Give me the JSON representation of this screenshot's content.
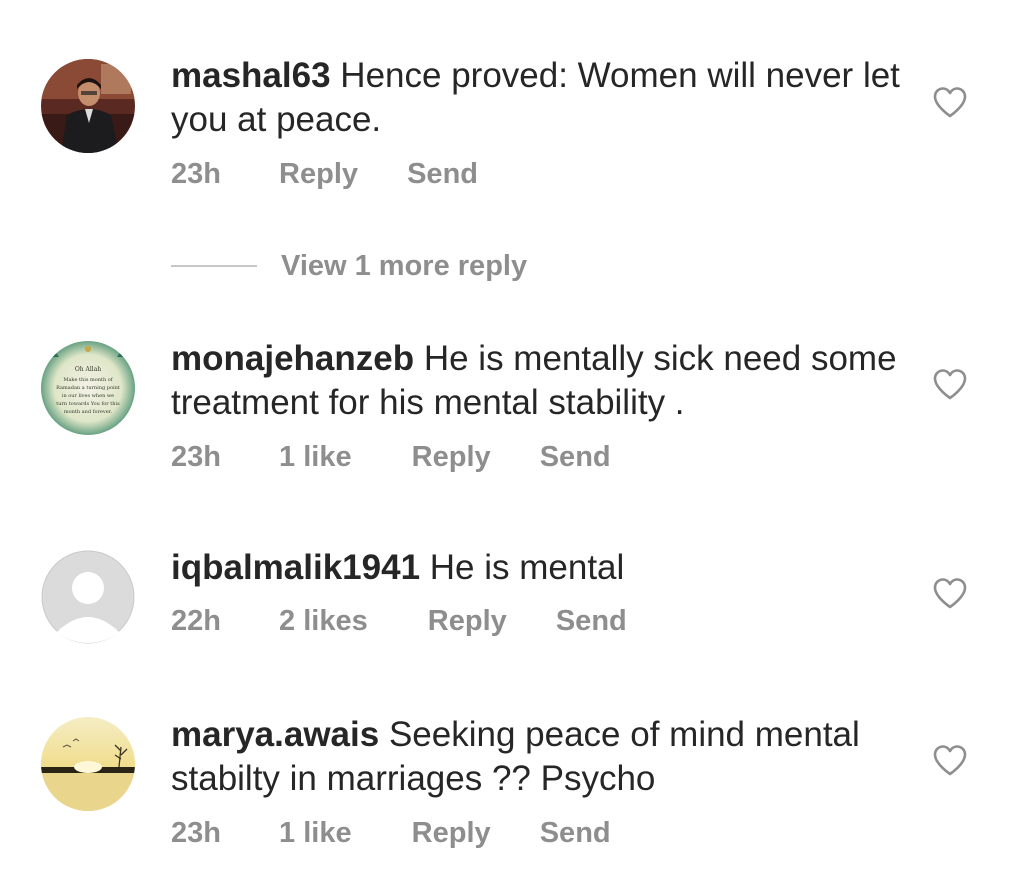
{
  "comments": [
    {
      "username": "mashal63",
      "text": "Hence proved: Women will never let you at peace.",
      "time": "23h",
      "likes": "",
      "reply_label": "Reply",
      "send_label": "Send"
    },
    {
      "username": "monajehanzeb",
      "text": "He is mentally  sick  need some treatment  for his mental stability .",
      "time": "23h",
      "likes": "1 like",
      "reply_label": "Reply",
      "send_label": "Send",
      "avatar_text": [
        "Oh Allah",
        "Make this month of",
        "Ramadan a turning point",
        "in our lives when we",
        "turn towards You for this",
        "month and forever."
      ]
    },
    {
      "username": "iqbalmalik1941",
      "text": "He is mental",
      "time": "22h",
      "likes": "2 likes",
      "reply_label": "Reply",
      "send_label": "Send"
    },
    {
      "username": "marya.awais",
      "text": "Seeking peace of mind mental stabilty in marriages ?? Psycho",
      "time": "23h",
      "likes": "1 like",
      "reply_label": "Reply",
      "send_label": "Send"
    }
  ],
  "view_more": {
    "label": "View 1 more reply"
  },
  "icons": {
    "heart": "heart-outline-icon",
    "avatar_placeholder": "default-user-icon"
  },
  "colors": {
    "primary_text": "#262626",
    "secondary_text": "#8e8e8e",
    "divider": "#c7c7c7",
    "placeholder_avatar": "#dbdbdb"
  }
}
